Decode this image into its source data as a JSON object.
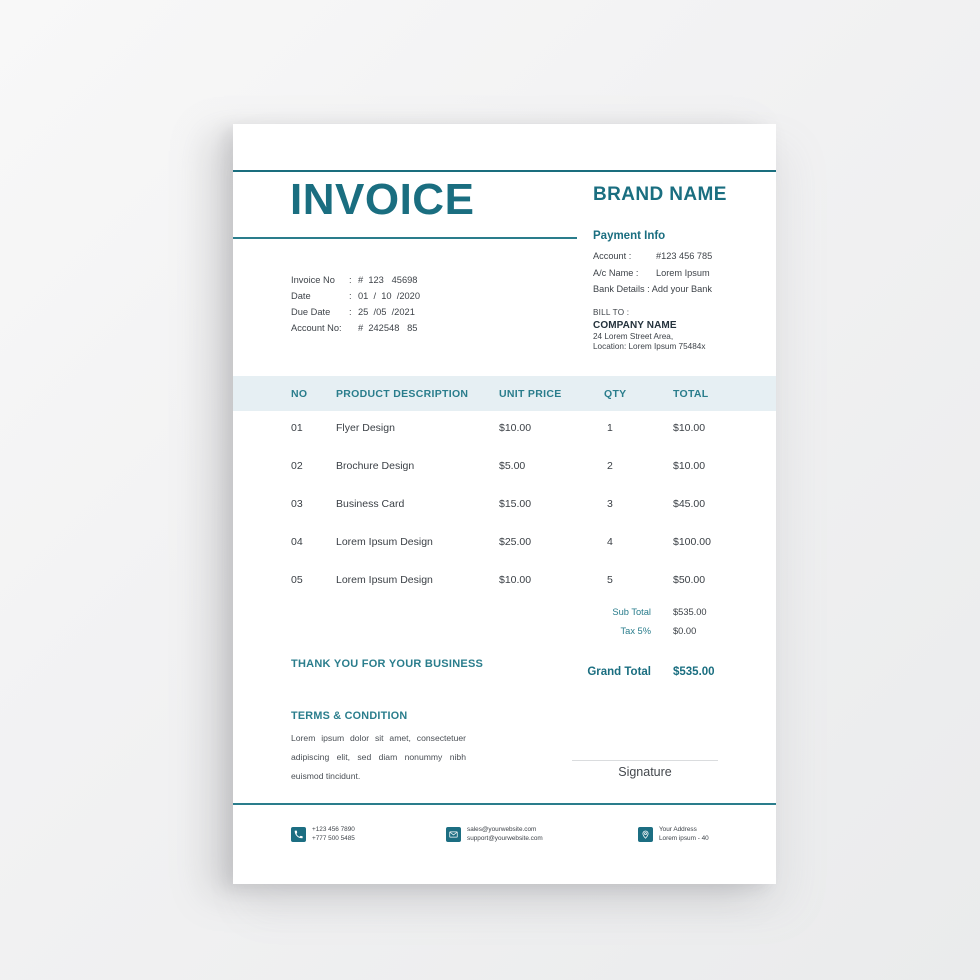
{
  "document": {
    "type": "invoice-template",
    "accent_color": "#1a6e80",
    "accent_color_light": "#2a7d8c",
    "table_header_bg": "#e6eff3",
    "body_text_color": "#3e4349",
    "paper_color": "#ffffff"
  },
  "header": {
    "title": "INVOICE",
    "brand_name": "BRAND NAME"
  },
  "payment_info": {
    "heading": "Payment Info",
    "account_label": "Account :",
    "account_value": "#123 456 785",
    "ac_name_label": "A/c Name :",
    "ac_name_value": "Lorem Ipsum",
    "bank_details": "Bank Details : Add your Bank"
  },
  "bill_to": {
    "label": "BILL TO :",
    "company": "COMPANY NAME",
    "address_line1": "24 Lorem Street Area,",
    "address_line2": "Location: Lorem Ipsum 75484x"
  },
  "invoice_meta": [
    {
      "label": "Invoice No",
      "sep": ":",
      "value": "#  123   45698"
    },
    {
      "label": "Date",
      "sep": ":",
      "value": "01  /  10  /2020"
    },
    {
      "label": "Due Date",
      "sep": ":",
      "value": "25  /05  /2021"
    },
    {
      "label": "Account  No:",
      "sep": "",
      "value": "#  242548   85"
    }
  ],
  "table": {
    "columns": [
      "NO",
      "PRODUCT DESCRIPTION",
      "UNIT PRICE",
      "QTY",
      "TOTAL"
    ],
    "rows": [
      {
        "no": "01",
        "description": "Flyer Design",
        "unit_price": "$10.00",
        "qty": "1",
        "total": "$10.00"
      },
      {
        "no": "02",
        "description": "Brochure Design",
        "unit_price": "$5.00",
        "qty": "2",
        "total": "$10.00"
      },
      {
        "no": "03",
        "description": "Business Card",
        "unit_price": "$15.00",
        "qty": "3",
        "total": "$45.00"
      },
      {
        "no": "04",
        "description": "Lorem Ipsum Design",
        "unit_price": "$25.00",
        "qty": "4",
        "total": "$100.00"
      },
      {
        "no": "05",
        "description": "Lorem Ipsum Design",
        "unit_price": "$10.00",
        "qty": "5",
        "total": "$50.00"
      }
    ]
  },
  "totals": {
    "sub_total_label": "Sub Total",
    "sub_total_value": "$535.00",
    "tax_label": "Tax 5%",
    "tax_value": "$0.00",
    "grand_total_label": "Grand Total",
    "grand_total_value": "$535.00"
  },
  "thank_you": "THANK YOU FOR YOUR BUSINESS",
  "terms": {
    "title": "TERMS & CONDITION",
    "body": "Lorem ipsum dolor sit amet, consectetuer adipiscing elit, sed diam nonummy nibh euismod tincidunt."
  },
  "signature": {
    "label": "Signature"
  },
  "footer": {
    "phone": {
      "icon": "phone-icon",
      "line1": "+123 456 7890",
      "line2": "+777 500 5485"
    },
    "email": {
      "icon": "envelope-icon",
      "line1": "sales@yourwebsite.com",
      "line2": "support@yourwebsite.com"
    },
    "address": {
      "icon": "location-pin-icon",
      "line1": "Your Address",
      "line2": "Lorem ipsum - 40"
    }
  }
}
